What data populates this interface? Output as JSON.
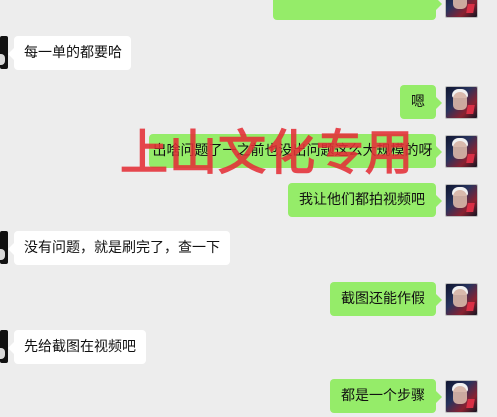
{
  "conversation": {
    "messages": [
      {
        "side": "right",
        "text": ""
      },
      {
        "side": "left",
        "text": "每一单的都要哈"
      },
      {
        "side": "right",
        "text": "嗯"
      },
      {
        "side": "right",
        "text": "出啥问题了一之前也没出问题这么大规模的呀"
      },
      {
        "side": "right",
        "text": "我让他们都拍视频吧"
      },
      {
        "side": "left",
        "text": "没有问题，就是刷完了，查一下"
      },
      {
        "side": "right",
        "text": "截图还能作假"
      },
      {
        "side": "left",
        "text": "先给截图在视频吧"
      },
      {
        "side": "right",
        "text": "都是一个步骤"
      }
    ]
  },
  "watermark": {
    "text": "上山文化专用"
  },
  "colors": {
    "chat_background": "#ededed",
    "incoming_bubble": "#ffffff",
    "outgoing_bubble": "#95ec69",
    "watermark": "#e42f37"
  },
  "icons": {
    "avatar": "avatar-image"
  }
}
